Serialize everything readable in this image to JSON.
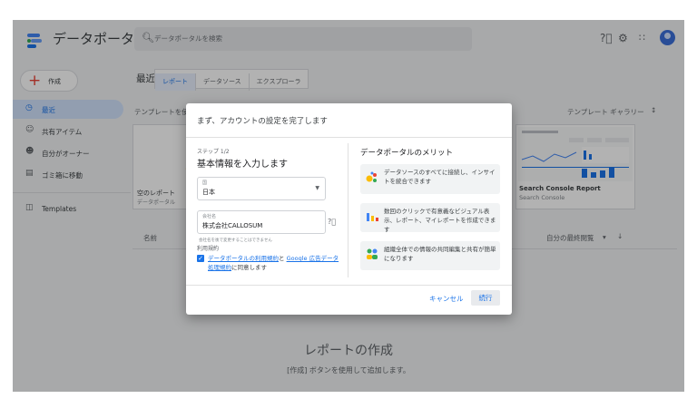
{
  "app": {
    "brand": "データポータル",
    "search_placeholder": "データポータルを検索"
  },
  "sidebar": {
    "create_label": "作成",
    "items": [
      {
        "label": "最近",
        "icon": "clock-icon"
      },
      {
        "label": "共有アイテム",
        "icon": "people-icon"
      },
      {
        "label": "自分がオーナー",
        "icon": "person-icon"
      },
      {
        "label": "ゴミ箱に移動",
        "icon": "trash-icon"
      },
      {
        "label": "Templates",
        "icon": "templates-icon"
      }
    ]
  },
  "main": {
    "title": "最近",
    "tabs": [
      "レポート",
      "データソース",
      "エクスプローラ"
    ],
    "template_section": "テンプレートを使",
    "gallery": "テンプレート ギャラリー",
    "blank_title": "空のレポート",
    "blank_sub": "データポータル",
    "sc_title": "Search Console Report",
    "sc_sub": "Search Console",
    "col_name": "名前",
    "col_last": "自分の最終閲覧",
    "empty_title": "レポートの作成",
    "empty_sub": "[作成] ボタンを使用して追加します。"
  },
  "modal": {
    "title": "まず、アカウントの設定を完了します",
    "step": "ステップ 1/2",
    "step_title": "基本情報を入力します",
    "country_label": "国",
    "country_value": "日本",
    "company_label": "会社名",
    "company_value": "株式会社CALLOSUM",
    "company_hint": "会社名を後で変更することはできません",
    "terms_label": "利用規約",
    "terms_link1": "データポータルの利用規約",
    "terms_mid": "と ",
    "terms_link2": "Google 広告データ処理規約",
    "terms_end": "に同意します",
    "benefits_title": "データポータルのメリット",
    "benefits": [
      "データソースのすべてに接続し、インサイトを統合できます",
      "数回のクリックで有意義なビジュアル表示、レポート、マイレポートを作成できます",
      "組織全体での情報の共同編集と共有が簡単になります"
    ],
    "cancel": "キャンセル",
    "continue": "続行"
  }
}
